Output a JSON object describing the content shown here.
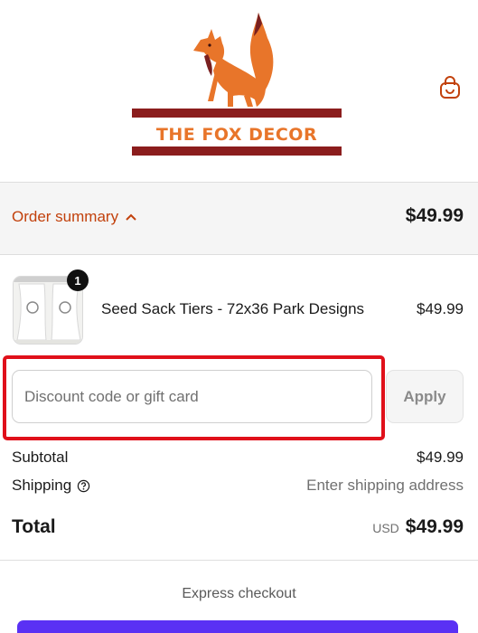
{
  "header": {
    "logo_text": "THE FOX DECOR",
    "cart_icon": "shopping-bag-icon"
  },
  "order_summary": {
    "toggle_label": "Order summary",
    "toggle_icon": "chevron-up-icon",
    "total": "$49.99"
  },
  "line_items": [
    {
      "quantity": "1",
      "name": "Seed Sack Tiers - 72x36 Park Designs",
      "price": "$49.99"
    }
  ],
  "discount": {
    "placeholder": "Discount code or gift card",
    "value": "",
    "apply_label": "Apply"
  },
  "totals": {
    "subtotal_label": "Subtotal",
    "subtotal_value": "$49.99",
    "shipping_label": "Shipping",
    "shipping_value": "Enter shipping address",
    "total_label": "Total",
    "currency": "USD",
    "total_value": "$49.99"
  },
  "express_checkout": {
    "label": "Express checkout"
  },
  "colors": {
    "accent": "#c2410c",
    "highlight": "#e0101a",
    "express_button": "#5a31f4",
    "logo_bars": "#8b1d1d",
    "logo_fox": "#e8752a"
  }
}
